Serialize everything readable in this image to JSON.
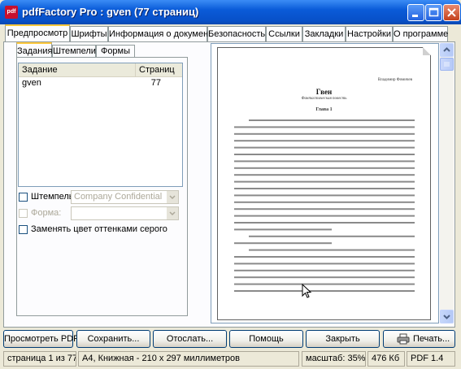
{
  "window": {
    "title": "pdfFactory Pro : gven (77 страниц)",
    "icon_label": "pdf"
  },
  "main_tabs": [
    {
      "label": "Предпросмотр",
      "selected": true
    },
    {
      "label": "Шрифты"
    },
    {
      "label": "Информация о документе"
    },
    {
      "label": "Безопасность"
    },
    {
      "label": "Ссылки"
    },
    {
      "label": "Закладки"
    },
    {
      "label": "Настройки"
    },
    {
      "label": "О программе"
    }
  ],
  "sub_tabs": [
    {
      "label": "Задания",
      "selected": true
    },
    {
      "label": "Штемпели"
    },
    {
      "label": "Формы"
    }
  ],
  "jobs_table": {
    "headers": [
      "Задание",
      "Страниц"
    ],
    "rows": [
      {
        "name": "gven",
        "pages": "77"
      }
    ]
  },
  "options": {
    "stamp_label": "Штемпель:",
    "stamp_value": "Company Confidential",
    "form_label": "Форма:",
    "form_value": "",
    "grayscale_label": "Заменять цвет оттенками серого"
  },
  "preview": {
    "author": "Владимир Фомичев",
    "title": "Гвен",
    "subtitle": "Фантастическая повесть",
    "chapter": "Глава 1"
  },
  "buttons": {
    "preview_pdf": "Просмотреть PDF",
    "save": "Сохранить...",
    "send": "Отослать...",
    "help": "Помощь",
    "close": "Закрыть",
    "print": "Печать..."
  },
  "status_bar": {
    "page": "страница 1 из 77",
    "paper": "A4, Книжная - 210 x 297 миллиметров",
    "zoom": "масштаб: 35%",
    "size": "476 Кб",
    "pdf_version": "PDF 1.4"
  },
  "colors": {
    "titlebar": "#0a5bd8",
    "tab_highlight": "#ffc83c",
    "face": "#ece9d8"
  }
}
